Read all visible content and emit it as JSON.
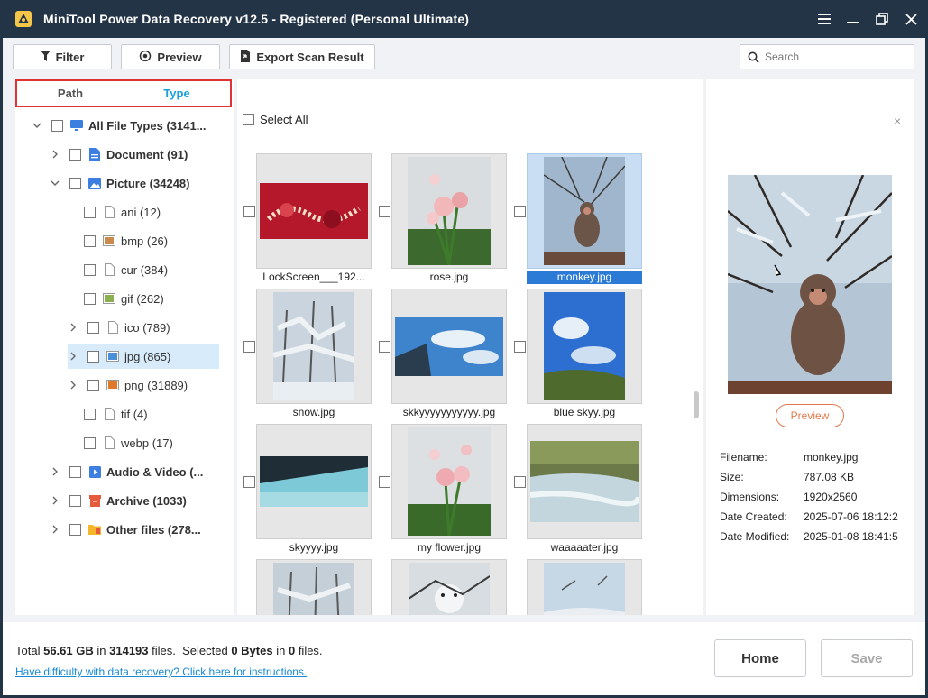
{
  "window": {
    "title": "MiniTool Power Data Recovery v12.5 - Registered (Personal Ultimate)",
    "controls": [
      "menu-icon",
      "minimize-icon",
      "restore-icon",
      "close-icon"
    ]
  },
  "toolbar": {
    "filter_label": "Filter",
    "preview_label": "Preview",
    "export_label": "Export Scan Result",
    "search_placeholder": "Search"
  },
  "tabs": {
    "path": "Path",
    "type": "Type",
    "active": "type"
  },
  "tree": {
    "root": "All File Types (3141...",
    "document": "Document (91)",
    "picture": "Picture (34248)",
    "ani": "ani (12)",
    "bmp": "bmp (26)",
    "cur": "cur (384)",
    "gif": "gif (262)",
    "ico": "ico (789)",
    "jpg": "jpg (865)",
    "png": "png (31889)",
    "tif": "tif (4)",
    "webp": "webp (17)",
    "audio_video": "Audio & Video (...",
    "archive": "Archive (1033)",
    "other": "Other files (278..."
  },
  "grid": {
    "select_all": "Select All",
    "files": [
      {
        "name": "LockScreen___192...",
        "thumb": "lockscreen"
      },
      {
        "name": "rose.jpg",
        "thumb": "rose"
      },
      {
        "name": "monkey.jpg",
        "thumb": "monkey",
        "selected": true
      },
      {
        "name": "snow.jpg",
        "thumb": "snow"
      },
      {
        "name": "skkyyyyyyyyyyy.jpg",
        "thumb": "sky"
      },
      {
        "name": "blue skyy.jpg",
        "thumb": "bluesky"
      },
      {
        "name": "skyyyy.jpg",
        "thumb": "skyyyy"
      },
      {
        "name": "my flower.jpg",
        "thumb": "flower"
      },
      {
        "name": "waaaaater.jpg",
        "thumb": "water"
      }
    ]
  },
  "preview": {
    "button_label": "Preview",
    "close_symbol": "×",
    "filename_label": "Filename:",
    "filename": "monkey.jpg",
    "size_label": "Size:",
    "size": "787.08 KB",
    "dimensions_label": "Dimensions:",
    "dimensions": "1920x2560",
    "created_label": "Date Created:",
    "created": "2025-07-06 18:12:2",
    "modified_label": "Date Modified:",
    "modified": "2025-01-08 18:41:5"
  },
  "footer": {
    "total_prefix": "Total",
    "total_size": "56.61 GB",
    "in_word": "in",
    "total_files": "314193",
    "files_word": "files.",
    "selected_prefix": "Selected",
    "selected_size": "0 Bytes",
    "selected_in": "in",
    "selected_files": "0",
    "selected_files_word": "files.",
    "help_link": "Have difficulty with data recovery? Click here for instructions.",
    "home_label": "Home",
    "save_label": "Save"
  },
  "colors": {
    "titlebar": "#243447",
    "tab_active": "#1aa0d8",
    "tab_highlight_border": "#e03434",
    "selection_blue": "#2b7bd6",
    "preview_button": "#e07a4a",
    "link": "#1a8ad4"
  }
}
